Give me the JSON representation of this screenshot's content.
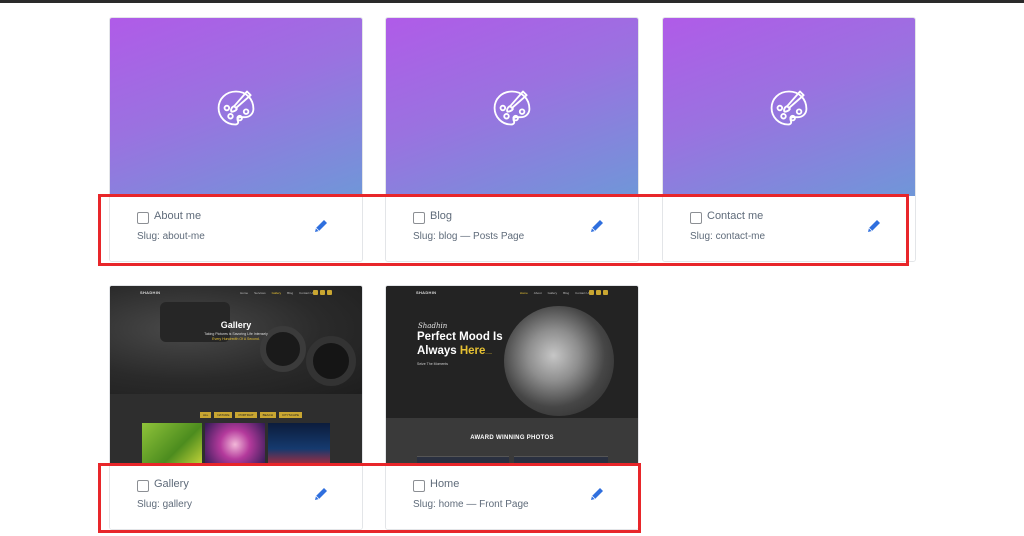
{
  "cards": [
    {
      "title": "About me",
      "slug": "Slug: about-me"
    },
    {
      "title": "Blog",
      "slug": "Slug: blog — Posts Page"
    },
    {
      "title": "Contact me",
      "slug": "Slug: contact-me"
    },
    {
      "title": "Gallery",
      "slug": "Slug: gallery",
      "preview": {
        "logo": "SHADHIN",
        "nav": [
          "Home",
          "Services",
          "Gallery",
          "Blog",
          "Contact Us"
        ],
        "heading": "Gallery",
        "line1": "Taking Pictures is Savoring Life Intensely",
        "line2": "Every Hundredth Of A Second.",
        "filters": [
          "ALL",
          "NATURE",
          "PORTRAIT",
          "BEACH",
          "CITYSCAPE"
        ]
      }
    },
    {
      "title": "Home",
      "slug": "Slug: home — Front Page",
      "preview": {
        "logo": "SHADHIN",
        "nav": [
          "Home",
          "About",
          "Gallery",
          "Blog",
          "Contact Us"
        ],
        "script": "Shadhin",
        "heading1": "Perfect Mood Is",
        "heading2a": "Always",
        "heading2b": "Here",
        "tail": "......",
        "subtitle": "Seize The Moments",
        "section": "AWARD WINNING PHOTOS"
      }
    }
  ],
  "icons": {
    "placeholder": "palette-icon",
    "edit": "pencil-icon",
    "checkbox": "checkbox"
  },
  "colors": {
    "gradient_start": "#b05be8",
    "gradient_end": "#6f97d8",
    "highlight": "#e8262a",
    "edit": "#2f6fde"
  }
}
